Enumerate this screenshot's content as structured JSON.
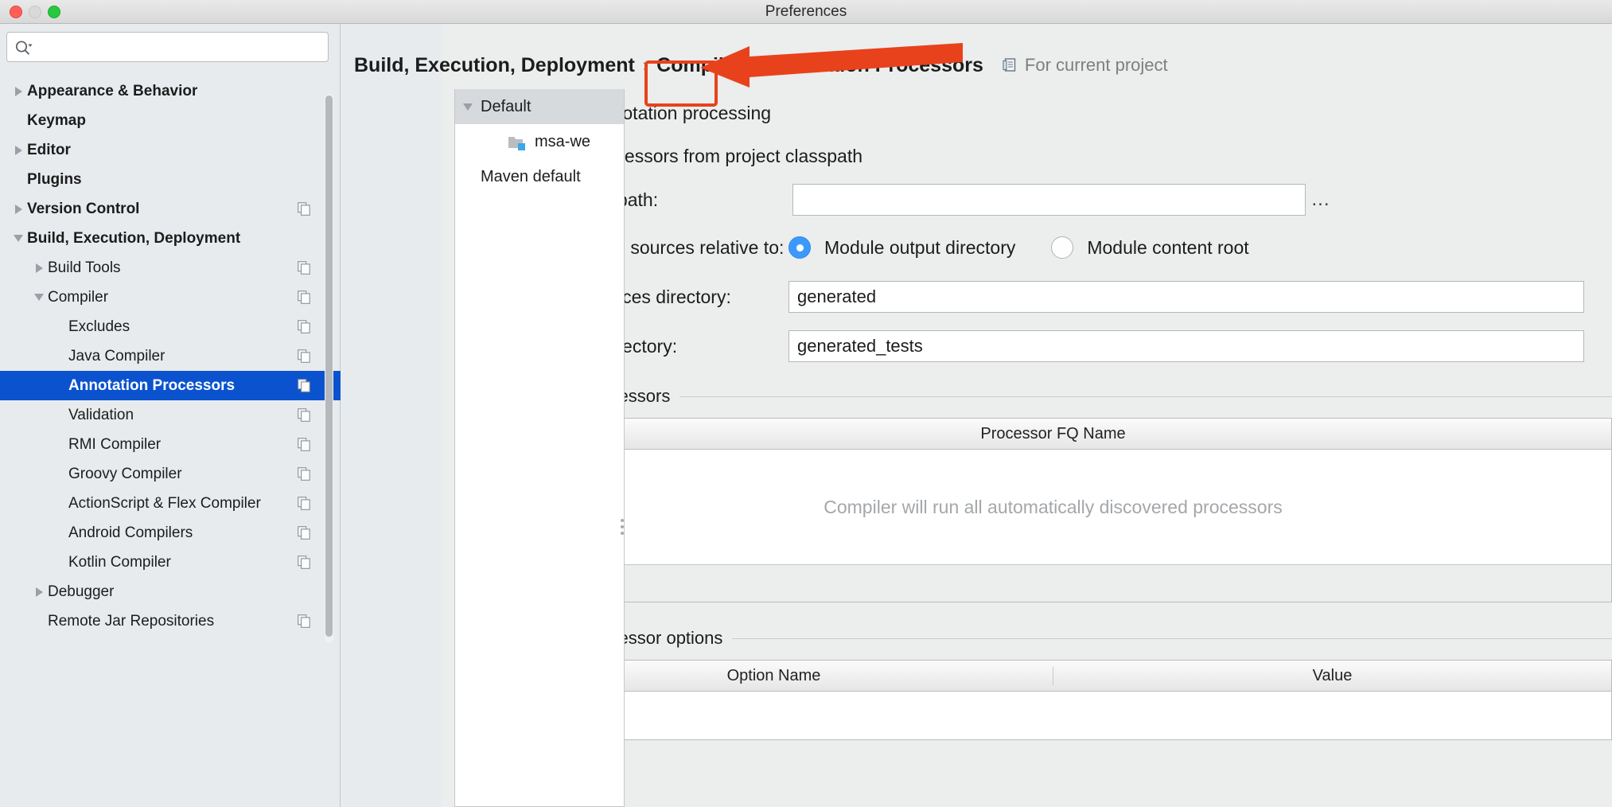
{
  "window": {
    "title": "Preferences",
    "traffic_lights": [
      "close-red",
      "minimize-yellow",
      "zoom-green"
    ]
  },
  "search": {
    "placeholder": "",
    "value": "",
    "icon": "search-icon"
  },
  "sidebar": {
    "items": [
      {
        "label": "Appearance & Behavior",
        "expander": "right",
        "indent": 0,
        "bold": true,
        "selected": false,
        "copy_icon": false
      },
      {
        "label": "Keymap",
        "expander": "none",
        "indent": 0,
        "bold": true,
        "selected": false,
        "copy_icon": false
      },
      {
        "label": "Editor",
        "expander": "right",
        "indent": 0,
        "bold": true,
        "selected": false,
        "copy_icon": false
      },
      {
        "label": "Plugins",
        "expander": "none",
        "indent": 0,
        "bold": true,
        "selected": false,
        "copy_icon": false
      },
      {
        "label": "Version Control",
        "expander": "right",
        "indent": 0,
        "bold": true,
        "selected": false,
        "copy_icon": true
      },
      {
        "label": "Build, Execution, Deployment",
        "expander": "down",
        "indent": 0,
        "bold": true,
        "selected": false,
        "copy_icon": false
      },
      {
        "label": "Build Tools",
        "expander": "right",
        "indent": 1,
        "bold": false,
        "selected": false,
        "copy_icon": true
      },
      {
        "label": "Compiler",
        "expander": "down",
        "indent": 1,
        "bold": false,
        "selected": false,
        "copy_icon": true
      },
      {
        "label": "Excludes",
        "expander": "none",
        "indent": 2,
        "bold": false,
        "selected": false,
        "copy_icon": true
      },
      {
        "label": "Java Compiler",
        "expander": "none",
        "indent": 2,
        "bold": false,
        "selected": false,
        "copy_icon": true
      },
      {
        "label": "Annotation Processors",
        "expander": "none",
        "indent": 2,
        "bold": false,
        "selected": true,
        "copy_icon": true
      },
      {
        "label": "Validation",
        "expander": "none",
        "indent": 2,
        "bold": false,
        "selected": false,
        "copy_icon": true
      },
      {
        "label": "RMI Compiler",
        "expander": "none",
        "indent": 2,
        "bold": false,
        "selected": false,
        "copy_icon": true
      },
      {
        "label": "Groovy Compiler",
        "expander": "none",
        "indent": 2,
        "bold": false,
        "selected": false,
        "copy_icon": true
      },
      {
        "label": "ActionScript & Flex Compiler",
        "expander": "none",
        "indent": 2,
        "bold": false,
        "selected": false,
        "copy_icon": true
      },
      {
        "label": "Android Compilers",
        "expander": "none",
        "indent": 2,
        "bold": false,
        "selected": false,
        "copy_icon": true
      },
      {
        "label": "Kotlin Compiler",
        "expander": "none",
        "indent": 2,
        "bold": false,
        "selected": false,
        "copy_icon": true
      },
      {
        "label": "Debugger",
        "expander": "right",
        "indent": 1,
        "bold": false,
        "selected": false,
        "copy_icon": false
      },
      {
        "label": "Remote Jar Repositories",
        "expander": "none",
        "indent": 1,
        "bold": false,
        "selected": false,
        "copy_icon": true
      }
    ]
  },
  "breadcrumb": {
    "parts": [
      "Build, Execution, Deployment",
      "Compiler",
      "Annotation Processors"
    ],
    "separator": "›",
    "scope_label": "For current project",
    "scope_icon": "project-scope-icon"
  },
  "profiles": {
    "items": [
      {
        "label": "Default",
        "expander": "down",
        "icon": "none",
        "indent": 0,
        "header": true
      },
      {
        "label": "msa-we",
        "expander": "none",
        "icon": "module-icon",
        "indent": 1,
        "header": false
      },
      {
        "label": "Maven default",
        "expander": "none",
        "icon": "none",
        "indent": 0,
        "header": false
      }
    ]
  },
  "settings": {
    "enable_annotation_processing": {
      "label": "Enable annotation processing",
      "checked": true
    },
    "processor_source": {
      "options": [
        {
          "label": "Obtain processors from project classpath",
          "selected": true
        },
        {
          "label": "Processor path:",
          "selected": false
        }
      ],
      "processor_path_value": "",
      "browse_button_label": "..."
    },
    "store_relative": {
      "label": "Store generated sources relative to:",
      "options": [
        {
          "label": "Module output directory",
          "selected": true
        },
        {
          "label": "Module content root",
          "selected": false
        }
      ]
    },
    "production_sources": {
      "label": "Production sources directory:",
      "value": "generated"
    },
    "test_sources": {
      "label": "Test sources directory:",
      "value": "generated_tests"
    },
    "processors_section": {
      "title": "Annotation Processors",
      "column_header": "Processor FQ Name",
      "empty_message": "Compiler will run all automatically discovered processors",
      "add_label": "+",
      "remove_label": "−"
    },
    "options_section": {
      "title": "Annotation Processor options",
      "columns": [
        "Option Name",
        "Value"
      ],
      "rows": []
    }
  },
  "annotation": {
    "highlight_color": "#e8421c",
    "target": "enable-annotation-processing-checkbox"
  },
  "colors": {
    "selection_blue": "#0b53ce",
    "control_blue": "#3b99fc",
    "window_bg": "#e8ebee",
    "panel_bg": "#eceded"
  }
}
